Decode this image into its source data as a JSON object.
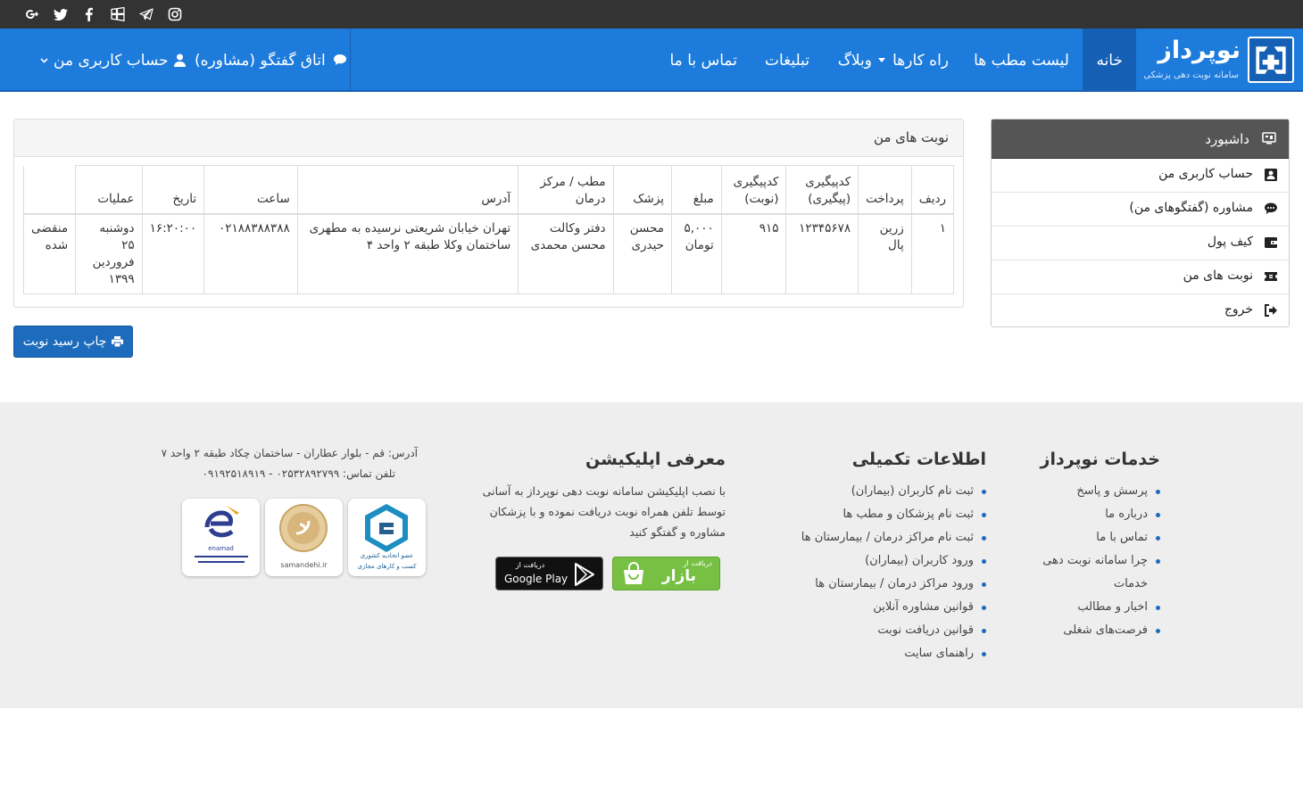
{
  "social": {
    "icons": [
      "google-plus-icon",
      "twitter-icon",
      "facebook-icon",
      "windows-icon",
      "telegram-icon",
      "instagram-icon"
    ]
  },
  "brand": {
    "name": "نوپرداز",
    "subtitle": "سامانه نوبت دهی پزشکی"
  },
  "nav": {
    "home": "خانه",
    "clinics": "لیست مطب ها",
    "guides": "راه کارها",
    "blog": "وبلاگ",
    "ads": "تبلیغات",
    "contact": "تماس با ما",
    "chat": "اتاق گفتگو (مشاوره)",
    "account": "حساب کاربری من"
  },
  "panel": {
    "title": "نوبت های من",
    "columns": [
      "ردیف",
      "پرداخت",
      "کدپیگیری (پیگیری)",
      "کدپیگیری (نوبت)",
      "مبلغ",
      "پزشک",
      "مطب / مرکز درمان",
      "آدرس",
      "ساعت",
      "تاریخ",
      "عملیات",
      ""
    ],
    "rows": [
      {
        "index": "۱",
        "payment": "زرین پال",
        "tracking": "۱۲۳۴۵۶۷۸",
        "queue_code": "۹۱۵",
        "amount": "۵,۰۰۰ تومان",
        "doctor": "محسن حیدری",
        "clinic": "دفتر وکالت محسن محمدی",
        "address": "تهران خیابان شریعتی نرسیده به مطهری ساختمان وکلا طبقه ۲ واحد ۴",
        "time": "۰۲۱۸۸۳۸۸۳۸۸",
        "date": "۱۶:۲۰:۰۰",
        "ops": "دوشنبه ۲۵ فروردین ۱۳۹۹",
        "status": "منقضی شده"
      }
    ]
  },
  "print_button": "چاپ رسید نوبت",
  "sidebar": {
    "title": "داشبورد",
    "items": [
      {
        "label": "حساب کاربری من",
        "icon": "contact-card-icon"
      },
      {
        "label": "مشاوره (گفتگوهای من)",
        "icon": "chat-bubble-icon"
      },
      {
        "label": "کیف پول",
        "icon": "wallet-icon"
      },
      {
        "label": "نوبت های من",
        "icon": "ticket-icon"
      },
      {
        "label": "خروج",
        "icon": "sign-out-icon"
      }
    ]
  },
  "footer": {
    "services_title": "خدمات نوپرداز",
    "services": [
      "پرسش و پاسخ",
      "درباره ما",
      "تماس با ما",
      "چرا سامانه نوبت دهی",
      "اخبار و مطالب",
      "فرصت‌های شغلی"
    ],
    "services_wrap": "خدمات",
    "info_title": "اطلاعات تکمیلی",
    "info": [
      "ثبت نام کاربران (بیماران)",
      "ثبت نام پزشکان و مطب ها",
      "ثبت نام مراکز درمان / بیمارستان ها",
      "ورود کاربران (بیماران)",
      "ورود مراکز درمان / بیمارستان ها",
      "قوانین مشاوره آنلاین",
      "قوانین دریافت نوبت",
      "راهنمای سایت"
    ],
    "app_title": "معرفی اپلیکیشن",
    "app_text_1": "با نصب اپلیکیشن سامانه نوبت دهی نوپرداز به آسانی",
    "app_text_2": "توسط تلفن همراه نوبت دریافت نموده و با پزشکان",
    "app_text_3": "مشاوره و گفتگو کنید",
    "bazaar_small": "دریافت از",
    "bazaar_big": "بازار",
    "gplay_small": "دریافت از",
    "gplay_big": "Google Play",
    "address": "آدرس: قم - بلوار عطاران - ساختمان چکاد طبقه ۲ واحد ۷",
    "phone": "تلفن تماس: ۰۲۵۳۲۸۹۲۷۹۹ - ۰۹۱۹۲۵۱۸۹۱۹",
    "badge_1": "عضو اتحادیه کشوری",
    "badge_1b": "کسب و کارهای مجازی",
    "badge_2": "samandehi.ir",
    "badge_3": "enamad"
  }
}
